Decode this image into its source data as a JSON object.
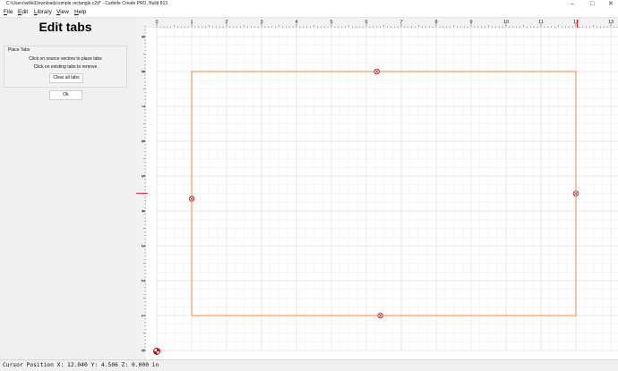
{
  "window": {
    "title": "C:\\Users\\willa\\Downloads\\simple rectangle.c2d* - Carbide Create PRO, Build 813",
    "minimize": "–",
    "maximize": "□",
    "close": "✕"
  },
  "menu": [
    "File",
    "Edit",
    "Library",
    "View",
    "Help"
  ],
  "panel": {
    "heading": "Edit tabs",
    "group_label": "Place Tabs",
    "instruction_1": "Click on source vectors to place tabs",
    "instruction_2": "Click on existing tabs to remove",
    "clear_button": "Clear all tabs",
    "ok_button": "Ok"
  },
  "rulers": {
    "x_labels": [
      "0",
      "1",
      "2",
      "3",
      "4",
      "5",
      "6",
      "7",
      "8",
      "9",
      "10",
      "11",
      "12",
      "13"
    ],
    "y_labels": [
      "9",
      "8",
      "7",
      "6",
      "5",
      "4",
      "3",
      "2",
      "1",
      "0"
    ]
  },
  "geometry": {
    "rectangle": {
      "x_min": 1,
      "x_max": 12,
      "y_min": 1,
      "y_max": 8
    },
    "tabs": [
      {
        "x": 6.3,
        "y": 8
      },
      {
        "x": 1,
        "y": 4.35
      },
      {
        "x": 12,
        "y": 4.5
      },
      {
        "x": 6.4,
        "y": 1
      }
    ],
    "cursor": {
      "x": 12.04,
      "y": 4.506
    }
  },
  "colors": {
    "vector": "#ee8844",
    "tab": "#cc2222",
    "cursor_marker": "#e02020"
  },
  "status": {
    "text": "Cursor Position X: 12.040 Y: 4.506 Z: 0.000 in"
  }
}
